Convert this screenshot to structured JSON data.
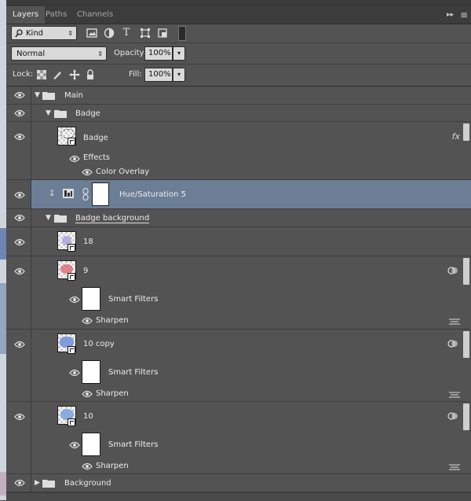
{
  "tabs": [
    {
      "label": "Layers",
      "active": true
    },
    {
      "label": "Paths",
      "active": false
    },
    {
      "label": "Channels",
      "active": false
    }
  ],
  "tab_collapse": "▸▸",
  "tab_menu": "≡",
  "filter": {
    "kind_label": "Kind",
    "icons": [
      "image-filter-icon",
      "adjustment-filter-icon",
      "type-filter-icon",
      "shape-filter-icon",
      "smart-object-filter-icon",
      "filter-toggle-icon"
    ]
  },
  "blend": {
    "mode": "Normal",
    "opacity_label": "Opacity:",
    "opacity_value": "100%"
  },
  "lock": {
    "label": "Lock:",
    "fill_label": "Fill:",
    "fill_value": "100%"
  },
  "layers": {
    "main": "Main",
    "badge_group": "Badge",
    "badge_layer": "Badge",
    "effects": "Effects",
    "color_overlay": "Color Overlay",
    "hue_sat": "Hue/Saturation 5",
    "badge_background": "Badge background",
    "l18": "18",
    "l9": "9",
    "l9_smart": "Smart Filters",
    "l9_sharpen": "Sharpen",
    "l10copy": "10 copy",
    "l10copy_smart": "Smart Filters",
    "l10copy_sharpen": "Sharpen",
    "l10": "10",
    "l10_smart": "Smart Filters",
    "l10_sharpen": "Sharpen",
    "background": "Background"
  },
  "fx_label": "fx",
  "colors": {
    "selected_row": "#6c7e96",
    "panel": "#535353"
  }
}
